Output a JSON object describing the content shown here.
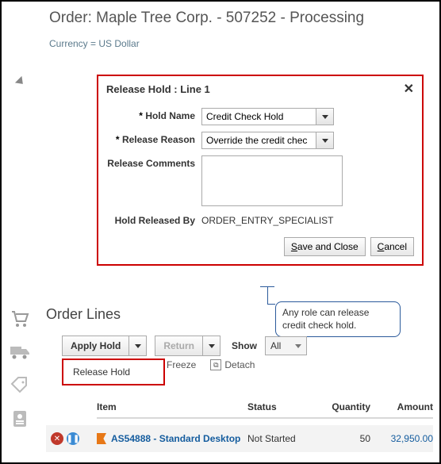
{
  "header": {
    "title": "Order: Maple Tree Corp. - 507252 - Processing"
  },
  "currency_label": "Currency = US Dollar",
  "modal": {
    "title": "Release Hold : Line 1",
    "hold_name_label": "Hold Name",
    "hold_name_value": "Credit Check Hold",
    "release_reason_label": "Release Reason",
    "release_reason_value": "Override the credit chec",
    "comments_label": "Release Comments",
    "comments_value": "",
    "released_by_label": "Hold Released By",
    "released_by_value": "ORDER_ENTRY_SPECIALIST",
    "save_label": "Save and Close",
    "cancel_label": "Cancel"
  },
  "callout": {
    "text": "Any role can release credit check hold."
  },
  "lines": {
    "section_title": "Order Lines",
    "apply_hold_label": "Apply Hold",
    "return_label": "Return",
    "show_label": "Show",
    "show_value": "All",
    "release_hold_label": "Release Hold",
    "freeze_label": "Freeze",
    "detach_label": "Detach",
    "columns": {
      "item": "Item",
      "status": "Status",
      "quantity": "Quantity",
      "amount": "Amount"
    },
    "row": {
      "item": "AS54888 - Standard Desktop",
      "status": "Not Started",
      "quantity": "50",
      "amount": "32,950.00"
    }
  }
}
